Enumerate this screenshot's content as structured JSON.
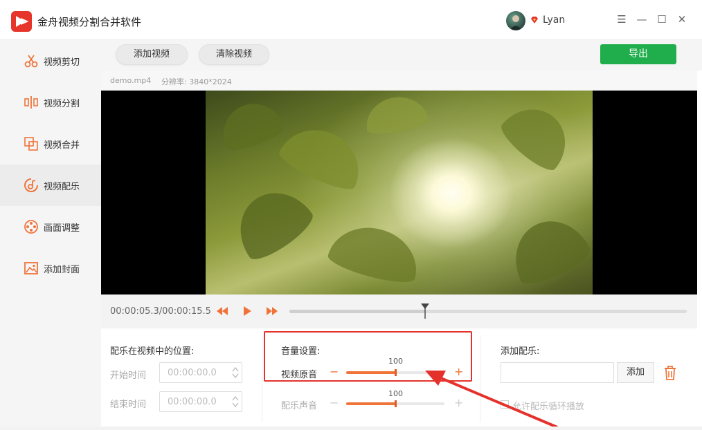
{
  "app": {
    "title": "金舟视频分割合并软件",
    "username": "Lyan"
  },
  "window": {
    "menu": "☰",
    "minimize": "—",
    "maximize": "☐",
    "close": "✕"
  },
  "sidebar": {
    "items": [
      {
        "label": "视频剪切",
        "icon": "scissors-icon",
        "active": false
      },
      {
        "label": "视频分割",
        "icon": "split-icon",
        "active": false
      },
      {
        "label": "视频合并",
        "icon": "merge-icon",
        "active": false
      },
      {
        "label": "视频配乐",
        "icon": "music-icon",
        "active": true
      },
      {
        "label": "画面调整",
        "icon": "film-reel-icon",
        "active": false
      },
      {
        "label": "添加封面",
        "icon": "image-icon",
        "active": false
      }
    ]
  },
  "toolbar": {
    "add_video": "添加视频",
    "clear_video": "清除视频",
    "export": "导出"
  },
  "file": {
    "name": "demo.mp4",
    "resolution_label": "分辨率: 3840*2024"
  },
  "player": {
    "time": "00:00:05.3/00:00:15.5",
    "progress": 0.342
  },
  "music_position": {
    "title": "配乐在视频中的位置:",
    "start_label": "开始时间",
    "start_value": "00:00:00.0",
    "end_label": "结束时间",
    "end_value": "00:00:00.0"
  },
  "volume": {
    "title": "音量设置:",
    "original_label": "视频原音",
    "original_value": "100",
    "original_level": 0.5,
    "music_label": "配乐声音",
    "music_value": "100",
    "music_level": 0.5,
    "minus": "−",
    "plus": "+"
  },
  "add_music": {
    "title": "添加配乐:",
    "add_button": "添加",
    "loop_label": "允许配乐循环播放"
  },
  "colors": {
    "accent_orange": "#f0743a",
    "export_green": "#1fae4b",
    "highlight_red": "#e5312b"
  }
}
